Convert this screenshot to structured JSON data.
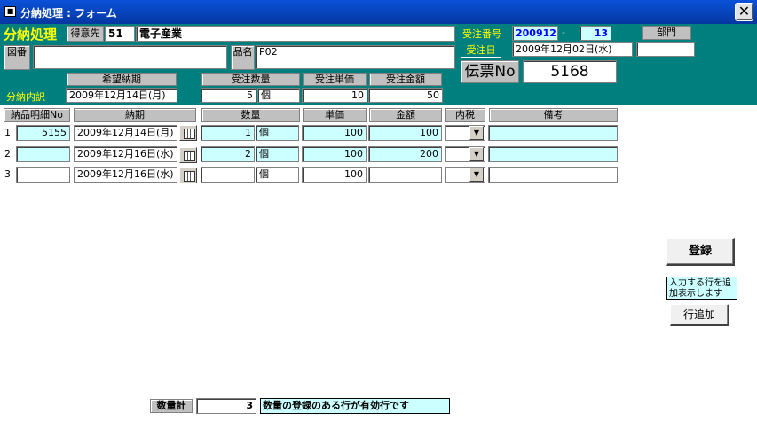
{
  "window": {
    "title": "分納処理 : フォーム",
    "close_glyph": "✕",
    "icon_glyph": "■"
  },
  "header": {
    "form_title": "分納処理",
    "customer_label": "得意先",
    "customer_code": "51",
    "customer_name": "電子産業",
    "drawing_label": "図番",
    "drawing_value": "",
    "product_label": "品名",
    "product_value": "P02",
    "order_no_label": "受注番号",
    "order_no": "200912",
    "order_dash": "-",
    "order_sub": "13",
    "department_label": "部門",
    "department_value": "",
    "order_date_label": "受注日",
    "order_date": "2009年12月02日(水)",
    "date_extra": "",
    "slip_label": "伝票No",
    "slip_no": "5168",
    "desired_date_label": "希望納期",
    "order_qty_label": "受注数量",
    "order_price_label": "受注単価",
    "order_amount_label": "受注金額",
    "split_detail_label": "分納内訳",
    "desired_date": "2009年12月14日(月)",
    "order_qty": "5",
    "order_unit": "個",
    "order_price": "10",
    "order_amount": "50"
  },
  "table": {
    "columns": [
      "納品明細No",
      "納期",
      "数量",
      "単価",
      "金額",
      "内税",
      "備考"
    ],
    "rows": [
      {
        "index": "1",
        "detail_no": "5155",
        "due_date": "2009年12月14日(月)",
        "qty": "1",
        "unit": "個",
        "price": "100",
        "amount": "100",
        "tax": "",
        "note": ""
      },
      {
        "index": "2",
        "detail_no": "",
        "due_date": "2009年12月16日(水)",
        "qty": "2",
        "unit": "個",
        "price": "100",
        "amount": "200",
        "tax": "",
        "note": ""
      },
      {
        "index": "3",
        "detail_no": "",
        "due_date": "2009年12月16日(水)",
        "qty": "",
        "unit": "個",
        "price": "100",
        "amount": "",
        "tax": "",
        "note": ""
      }
    ]
  },
  "actions": {
    "register_label": "登録",
    "add_row_hint": "入力する行を追加表示します",
    "add_row_label": "行追加"
  },
  "footer": {
    "qty_total_label": "数量計",
    "qty_total": "3",
    "qty_note": "数量の登録のある行が有効行です"
  },
  "colors": {
    "header_bg": "#007f7f",
    "title_bar": "#0641b8",
    "highlight": "#ccffff",
    "accent_text": "#ffff00"
  }
}
